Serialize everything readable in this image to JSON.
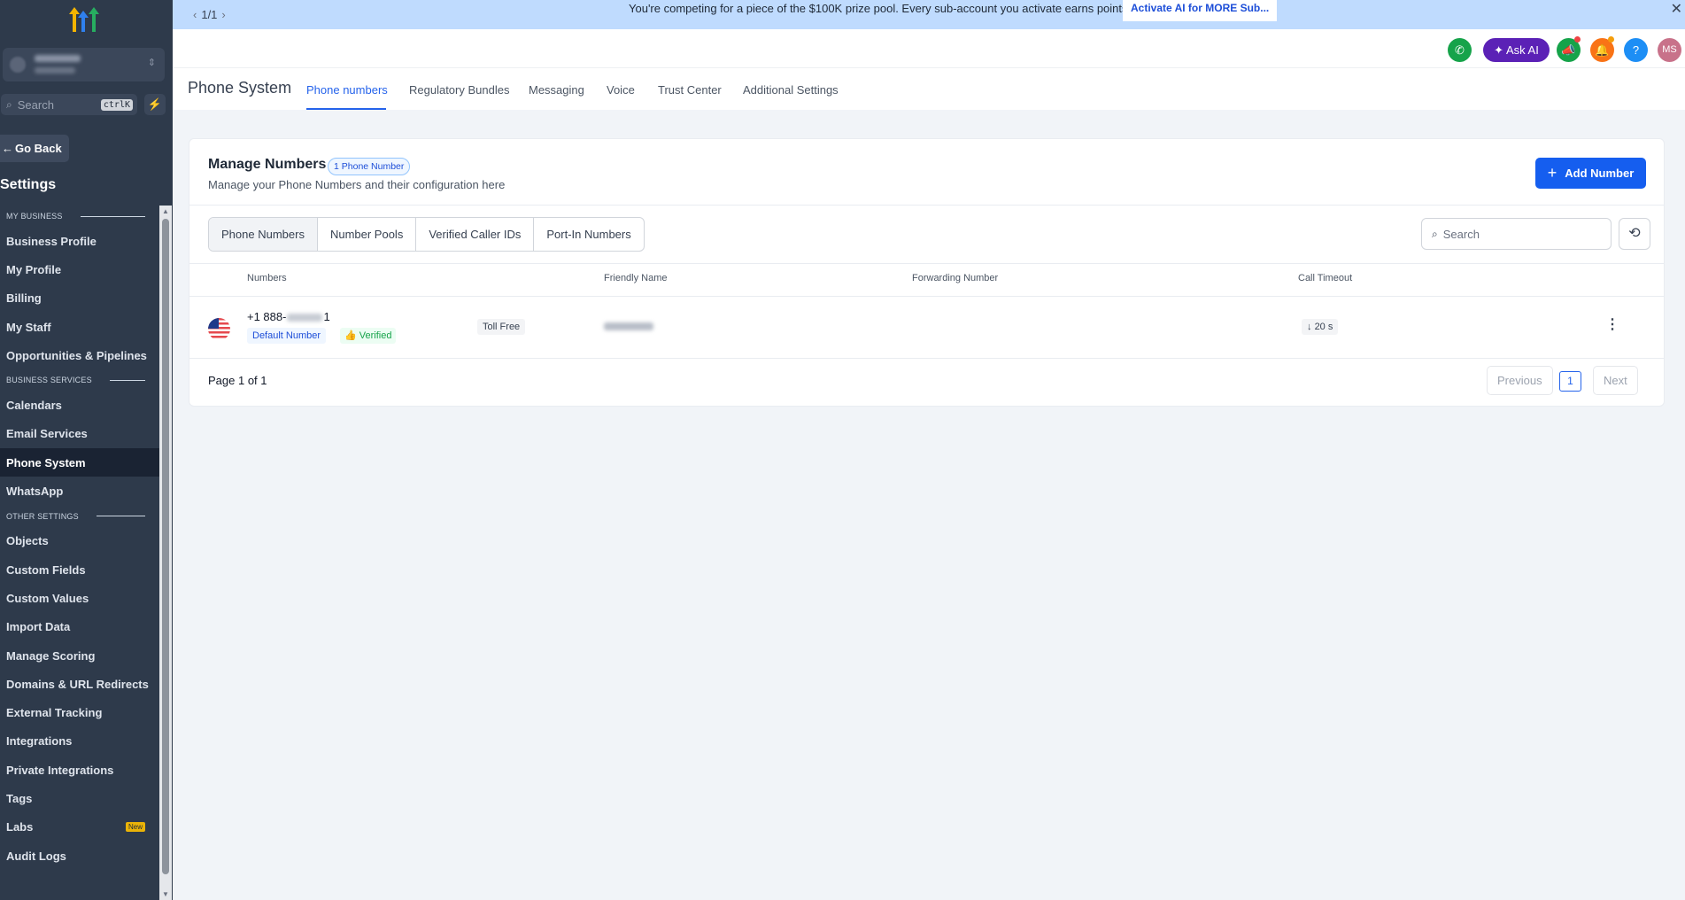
{
  "banner": {
    "pager": "1/1",
    "message": "You're competing for a piece of the $100K prize pool. Every sub-account you activate earns points.",
    "cta": "Activate AI for MORE Sub..."
  },
  "sidebar": {
    "search_placeholder": "Search",
    "search_shortcut": "ctrlK",
    "go_back": "Go Back",
    "settings_title": "Settings",
    "sections": [
      {
        "title": "MY BUSINESS",
        "items": [
          "Business Profile",
          "My Profile",
          "Billing",
          "My Staff",
          "Opportunities & Pipelines"
        ]
      },
      {
        "title": "BUSINESS SERVICES",
        "items": [
          "Calendars",
          "Email Services",
          "Phone System",
          "WhatsApp"
        ]
      },
      {
        "title": "OTHER SETTINGS",
        "items": [
          "Objects",
          "Custom Fields",
          "Custom Values",
          "Import Data",
          "Manage Scoring",
          "Domains & URL Redirects",
          "External Tracking",
          "Integrations",
          "Private Integrations",
          "Tags",
          "Labs",
          "Audit Logs"
        ]
      }
    ],
    "active_item": "Phone System",
    "labs_badge": "New"
  },
  "header": {
    "ask_ai": "Ask AI",
    "avatar_initials": "MS"
  },
  "subheader": {
    "title": "Phone System",
    "tabs": [
      "Phone numbers",
      "Regulatory Bundles",
      "Messaging",
      "Voice",
      "Trust Center",
      "Additional Settings"
    ],
    "active_tab": "Phone numbers"
  },
  "card": {
    "title": "Manage Numbers",
    "count_badge": "1 Phone Number",
    "subtitle": "Manage your Phone Numbers and their configuration here",
    "add_button": "Add Number",
    "segments": [
      "Phone Numbers",
      "Number Pools",
      "Verified Caller IDs",
      "Port-In Numbers"
    ],
    "active_segment": "Phone Numbers",
    "search_placeholder": "Search",
    "columns": [
      "Numbers",
      "Friendly Name",
      "Forwarding Number",
      "Call Timeout"
    ],
    "rows": [
      {
        "number_prefix": "+1 888-",
        "number_suffix": "1",
        "default_tag": "Default Number",
        "verified_tag": "Verified",
        "type": "Toll Free",
        "call_timeout": "20 s"
      }
    ],
    "page_info": "Page 1 of 1",
    "previous": "Previous",
    "current_page": "1",
    "next": "Next"
  },
  "colors": {
    "sidebar_bg": "#2e3a4b",
    "accent": "#155eef",
    "banner_bg": "#bfdbfe"
  }
}
